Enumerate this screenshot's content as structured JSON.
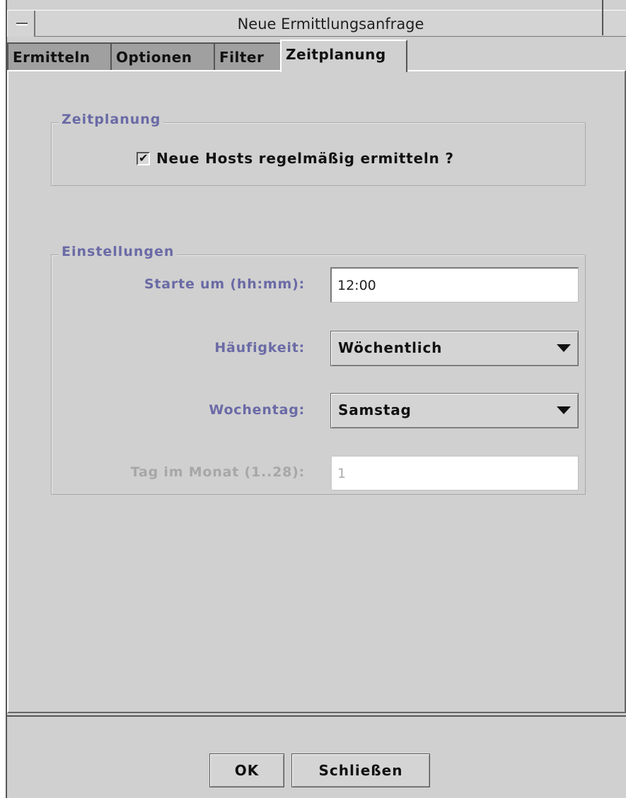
{
  "window": {
    "title": "Neue Ermittlungsanfrage"
  },
  "tabs": [
    {
      "label": "Ermitteln",
      "active": false
    },
    {
      "label": "Optionen",
      "active": false
    },
    {
      "label": "Filter",
      "active": false
    },
    {
      "label": "Zeitplanung",
      "active": true
    }
  ],
  "schedule_group": {
    "title": "Zeitplanung",
    "checkbox_label": "Neue Hosts regelmäßig ermitteln ?",
    "checkbox_checked": true
  },
  "settings_group": {
    "title": "Einstellungen",
    "start_time": {
      "label": "Starte um (hh:mm):",
      "value": "12:00"
    },
    "frequency": {
      "label": "Häufigkeit:",
      "value": "Wöchentlich"
    },
    "weekday": {
      "label": "Wochentag:",
      "value": "Samstag"
    },
    "day_of_month": {
      "label": "Tag im Monat (1..28):",
      "value": "1",
      "disabled": true
    }
  },
  "buttons": {
    "ok": "OK",
    "close": "Schließen"
  },
  "colors": {
    "panel_bg": "#d0d0d0",
    "group_title": "#6a6aa6",
    "disabled_text": "#a7a7a7"
  }
}
